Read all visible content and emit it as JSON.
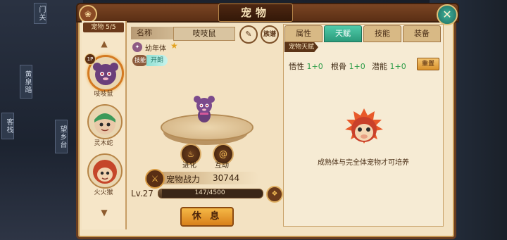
{
  "window": {
    "title": "宠物"
  },
  "background_signs": [
    "门关",
    "黄泉路",
    "望乡台",
    "客栈"
  ],
  "pet_list": {
    "count_label": "宠物 5/5",
    "selected_badge": "1P",
    "pets": [
      {
        "name": "吱吱鼠",
        "selected": true
      },
      {
        "name": "灵木蛇",
        "selected": false
      },
      {
        "name": "火火猴",
        "selected": false
      }
    ]
  },
  "pet_info": {
    "name_label": "名称",
    "name_value": "吱吱鼠",
    "rename_icon": "brush-icon",
    "lineage_label": "族谱",
    "stage": "幼年体",
    "skill_tag": "技能",
    "skill_status": "开朗",
    "actions": [
      {
        "label": "进化",
        "icon": "flame-icon"
      },
      {
        "label": "互动",
        "icon": "swirl-icon"
      }
    ],
    "power_label": "宠物战力",
    "power_value": "30744",
    "level": "Lv.27",
    "xp_text": "147/4500",
    "xp_fraction": 0.033,
    "rest_button": "休 息"
  },
  "tabs": [
    {
      "label": "属性",
      "active": false
    },
    {
      "label": "天赋",
      "active": true
    },
    {
      "label": "技能",
      "active": false
    },
    {
      "label": "装备",
      "active": false
    }
  ],
  "talent": {
    "section_label": "宠物天赋",
    "stats": [
      {
        "label": "悟性",
        "value": "1+0"
      },
      {
        "label": "根骨",
        "value": "1+0"
      },
      {
        "label": "潜能",
        "value": "1+0"
      }
    ],
    "reset_button": "重置",
    "hint": "成熟体与完全体宠物才可培养"
  },
  "colors": {
    "accent_green": "#2b9a7b",
    "gold": "#d8801a",
    "frame_brown": "#6a3d1f"
  }
}
